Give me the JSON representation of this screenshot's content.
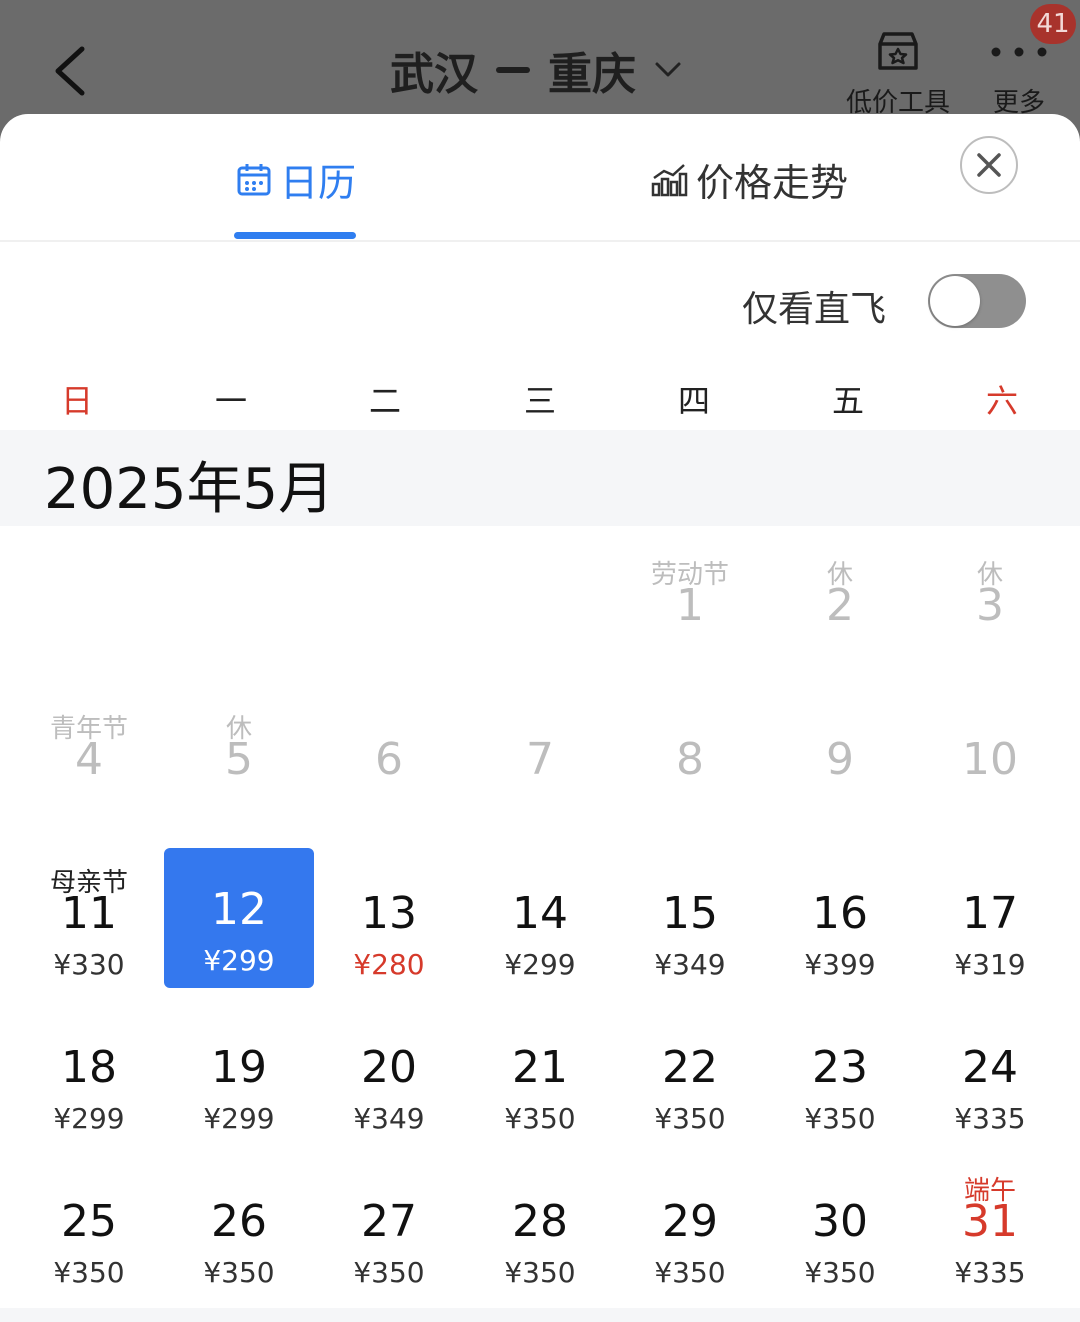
{
  "header": {
    "from": "武汉",
    "to": "重庆",
    "low_price_tool": "低价工具",
    "more": "更多",
    "badge": "41"
  },
  "tabs": [
    {
      "label": "日历",
      "active": true
    },
    {
      "label": "价格走势",
      "active": false
    }
  ],
  "direct_only": {
    "label": "仅看直飞",
    "on": false
  },
  "weekdays": [
    "日",
    "一",
    "二",
    "三",
    "四",
    "五",
    "六"
  ],
  "month_title": "2025年5月",
  "colors": {
    "accent": "#3478ee",
    "holiday_red": "#d63a2b",
    "past_gray": "#bdbdbd"
  },
  "days": [
    {
      "day": "1",
      "tag": "劳动节",
      "price": "",
      "past": true
    },
    {
      "day": "2",
      "tag": "休",
      "price": "",
      "past": true
    },
    {
      "day": "3",
      "tag": "休",
      "price": "",
      "past": true
    },
    {
      "day": "4",
      "tag": "青年节",
      "price": "",
      "past": true
    },
    {
      "day": "5",
      "tag": "休",
      "price": "",
      "past": true
    },
    {
      "day": "6",
      "tag": "",
      "price": "",
      "past": true
    },
    {
      "day": "7",
      "tag": "",
      "price": "",
      "past": true
    },
    {
      "day": "8",
      "tag": "",
      "price": "",
      "past": true
    },
    {
      "day": "9",
      "tag": "",
      "price": "",
      "past": true
    },
    {
      "day": "10",
      "tag": "",
      "price": "",
      "past": true
    },
    {
      "day": "11",
      "tag": "母亲节",
      "price": "¥330"
    },
    {
      "day": "12",
      "tag": "",
      "price": "¥299",
      "selected": true
    },
    {
      "day": "13",
      "tag": "",
      "price": "¥280",
      "lowest": true
    },
    {
      "day": "14",
      "tag": "",
      "price": "¥299"
    },
    {
      "day": "15",
      "tag": "",
      "price": "¥349"
    },
    {
      "day": "16",
      "tag": "",
      "price": "¥399"
    },
    {
      "day": "17",
      "tag": "",
      "price": "¥319"
    },
    {
      "day": "18",
      "tag": "",
      "price": "¥299"
    },
    {
      "day": "19",
      "tag": "",
      "price": "¥299"
    },
    {
      "day": "20",
      "tag": "",
      "price": "¥349"
    },
    {
      "day": "21",
      "tag": "",
      "price": "¥350"
    },
    {
      "day": "22",
      "tag": "",
      "price": "¥350"
    },
    {
      "day": "23",
      "tag": "",
      "price": "¥350"
    },
    {
      "day": "24",
      "tag": "",
      "price": "¥335"
    },
    {
      "day": "25",
      "tag": "",
      "price": "¥350"
    },
    {
      "day": "26",
      "tag": "",
      "price": "¥350"
    },
    {
      "day": "27",
      "tag": "",
      "price": "¥350"
    },
    {
      "day": "28",
      "tag": "",
      "price": "¥350"
    },
    {
      "day": "29",
      "tag": "",
      "price": "¥350"
    },
    {
      "day": "30",
      "tag": "",
      "price": "¥350"
    },
    {
      "day": "31",
      "tag": "端午",
      "price": "¥335",
      "holiday": true
    }
  ]
}
